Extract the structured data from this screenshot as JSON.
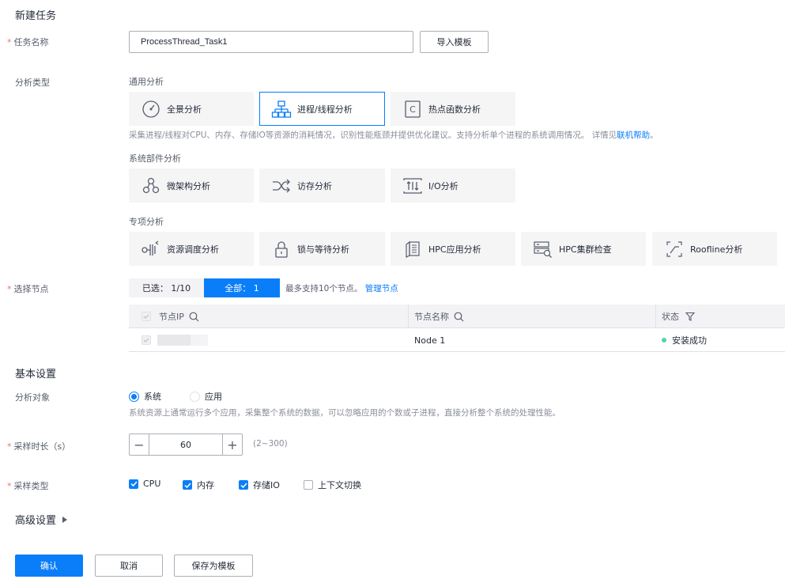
{
  "page": {
    "title": "新建任务",
    "basic_settings_title": "基本设置",
    "advanced_settings_title": "高级设置"
  },
  "colors": {
    "primary": "#0a7ef8",
    "required": "#f66f6a",
    "success": "#50d4ab"
  },
  "task_name": {
    "label": "任务名称",
    "required_mark": "*",
    "value": "ProcessThread_Task1",
    "import_template_button": "导入模板"
  },
  "analysis_type": {
    "label": "分析类型",
    "general": {
      "title": "通用分析",
      "items": [
        {
          "label": "全景分析",
          "icon": "gauge-icon"
        },
        {
          "label": "进程/线程分析",
          "icon": "process-tree-icon",
          "selected": true
        },
        {
          "label": "热点函数分析",
          "icon": "function-c-icon"
        }
      ],
      "description_prefix": "采集进程/线程对CPU、内存、存储IO等资源的消耗情况，识别性能瓶颈并提供优化建议。支持分析单个进程的系统调用情况。 详情见",
      "description_link": "联机帮助",
      "description_suffix": "。"
    },
    "system_parts": {
      "title": "系统部件分析",
      "items": [
        {
          "label": "微架构分析",
          "icon": "microarch-icon"
        },
        {
          "label": "访存分析",
          "icon": "shuffle-icon"
        },
        {
          "label": "I/O分析",
          "icon": "io-icon"
        }
      ]
    },
    "special": {
      "title": "专项分析",
      "items": [
        {
          "label": "资源调度分析",
          "icon": "scheduling-icon"
        },
        {
          "label": "锁与等待分析",
          "icon": "lock-icon"
        },
        {
          "label": "HPC应用分析",
          "icon": "hpc-app-icon"
        },
        {
          "label": "HPC集群检查",
          "icon": "hpc-cluster-icon"
        },
        {
          "label": "Roofline分析",
          "icon": "roofline-icon"
        }
      ]
    }
  },
  "node_select": {
    "label": "选择节点",
    "required_mark": "*",
    "selected_tab": "已选： 1/10",
    "all_tab": "全部： 1",
    "hint": "最多支持10个节点。",
    "manage_link": "管理节点",
    "table": {
      "columns": [
        "节点IP",
        "节点名称",
        "状态"
      ],
      "rows": [
        {
          "ip": "",
          "name": "Node 1",
          "status": "安装成功"
        }
      ]
    }
  },
  "analysis_target": {
    "label": "分析对象",
    "options": [
      "系统",
      "应用"
    ],
    "selected": "系统",
    "description": "系统资源上通常运行多个应用，采集整个系统的数据，可以忽略应用的个数或子进程，直接分析整个系统的处理性能。"
  },
  "sample_duration": {
    "label": "采样时长（s）",
    "required_mark": "*",
    "value": "60",
    "range": "(2~300)",
    "minus": "−",
    "plus": "+"
  },
  "sample_type": {
    "label": "采样类型",
    "required_mark": "*",
    "options": [
      {
        "label": "CPU",
        "checked": true
      },
      {
        "label": "内存",
        "checked": true
      },
      {
        "label": "存储IO",
        "checked": true
      },
      {
        "label": "上下文切换",
        "checked": false
      }
    ]
  },
  "footer": {
    "confirm": "确认",
    "cancel": "取消",
    "save_template": "保存为模板"
  }
}
